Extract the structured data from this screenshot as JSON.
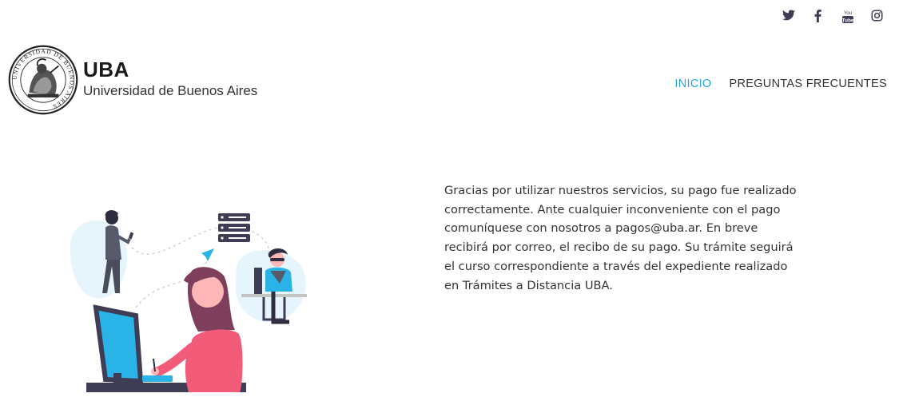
{
  "social": [
    {
      "name": "twitter-icon"
    },
    {
      "name": "facebook-icon"
    },
    {
      "name": "youtube-icon"
    },
    {
      "name": "instagram-icon"
    }
  ],
  "logo": {
    "title": "UBA",
    "subtitle": "Universidad de Buenos Aires",
    "seal_text": "UNIVERSIDAD DE BUENOS AIRES"
  },
  "nav": {
    "items": [
      {
        "label": "INICIO",
        "active": true
      },
      {
        "label": "PREGUNTAS FRECUENTES",
        "active": false
      }
    ]
  },
  "content": {
    "message": "Gracias por utilizar nuestros servicios, su pago fue realizado correctamente. Ante cualquier inconveniente con el pago comuníquese con nosotros a pagos@uba.ar. En breve recibirá por correo, el recibo de su pago. Su trámite seguirá el curso correspondiente a través del expediente realizado en Trámites a Distancia UBA."
  },
  "colors": {
    "accent": "#2aa3d6",
    "text": "#333333",
    "icon": "#3f3d56",
    "illustration_pink": "#f25c78",
    "illustration_blue": "#2ab3e6"
  }
}
